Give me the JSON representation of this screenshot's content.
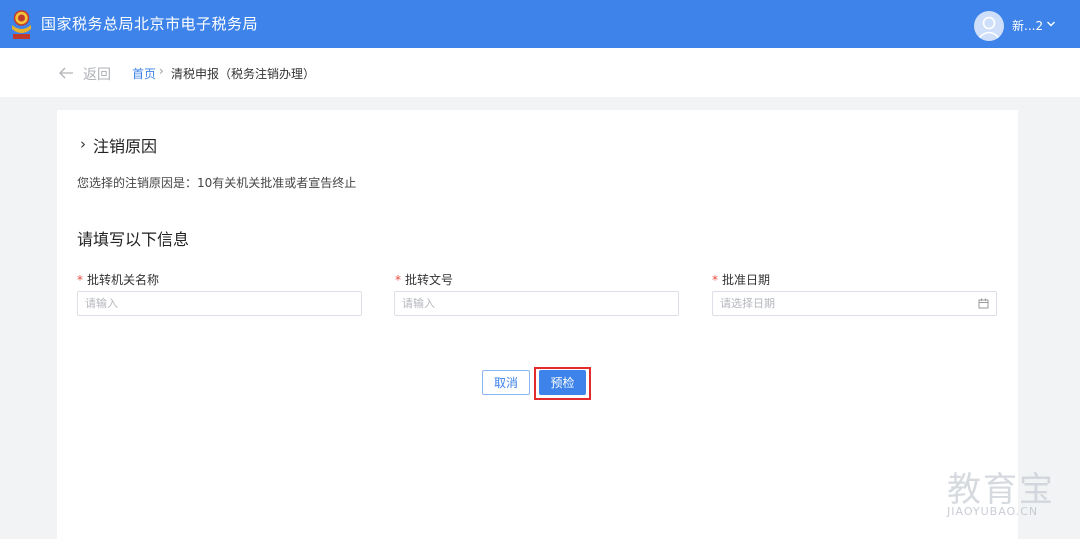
{
  "header": {
    "site_title": "国家税务总局北京市电子税务局",
    "user_name": "新...2",
    "user_dropdown_icon": "chevron-down-icon",
    "logo_icon": "tax-emblem-icon",
    "avatar_icon": "user-avatar-icon",
    "brand_color": "#3d83ea"
  },
  "nav": {
    "back_label": "返回",
    "back_icon": "arrow-left-icon",
    "breadcrumb_home": "首页",
    "breadcrumb_separator": "›",
    "breadcrumb_current": "清税申报（税务注销办理）"
  },
  "reason_section": {
    "chevron": "›",
    "title": "注销原因",
    "reason_text": "您选择的注销原因是：10有关机关批准或者宣告终止"
  },
  "info_section": {
    "title": "请填写以下信息",
    "required_mark": "*",
    "fields": [
      {
        "label": "批转机关名称",
        "placeholder": "请输入",
        "value": ""
      },
      {
        "label": "批转文号",
        "placeholder": "请输入",
        "value": ""
      },
      {
        "label": "批准日期",
        "placeholder": "请选择日期",
        "value": "",
        "icon": "calendar-icon"
      }
    ]
  },
  "actions": {
    "cancel_label": "取消",
    "precheck_label": "预检",
    "highlight_color": "#e32b2b"
  },
  "watermark": {
    "main": "教育宝",
    "domain": "JIAOYUBAO.CN"
  }
}
